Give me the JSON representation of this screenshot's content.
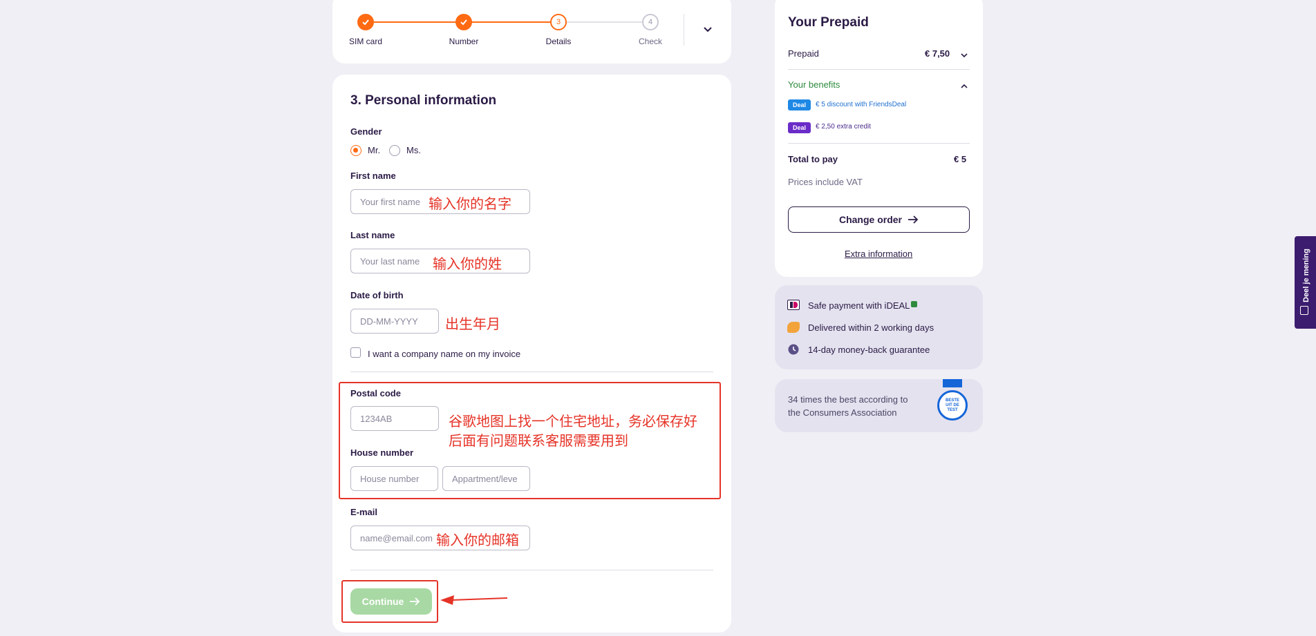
{
  "steps": [
    {
      "label": "SIM card",
      "status": "done",
      "number": ""
    },
    {
      "label": "Number",
      "status": "done",
      "number": ""
    },
    {
      "label": "Details",
      "status": "current",
      "number": "3"
    },
    {
      "label": "Check",
      "status": "todo",
      "number": "4"
    }
  ],
  "form": {
    "title": "3. Personal information",
    "gender_label": "Gender",
    "gender_options": [
      "Mr.",
      "Ms."
    ],
    "gender_selected": "Mr.",
    "first_name_label": "First name",
    "first_name_placeholder": "Your first name",
    "last_name_label": "Last name",
    "last_name_placeholder": "Your last name",
    "dob_label": "Date of birth",
    "dob_placeholder": "DD-MM-YYYY",
    "company_checkbox_label": "I want a company name on my invoice",
    "postal_label": "Postal code",
    "postal_placeholder": "1234AB",
    "house_label": "House number",
    "house_placeholder": "House number",
    "apartment_placeholder": "Appartment/leve",
    "email_label": "E-mail",
    "email_placeholder": "name@email.com",
    "continue_label": "Continue"
  },
  "annotations": {
    "first_name": "输入你的名字",
    "last_name": "输入你的姓",
    "dob": "出生年月",
    "address_line1": "谷歌地图上找一个住宅地址，务必保存好",
    "address_line2": "后面有问题联系客服需要用到",
    "email": "输入你的邮箱"
  },
  "summary": {
    "title": "Your Prepaid",
    "prepaid_label": "Prepaid",
    "prepaid_price": "€ 7,50",
    "benefits_label": "Your benefits",
    "deal_badge": "Deal",
    "benefit_1": "€ 5 discount with FriendsDeal",
    "benefit_2": "€ 2,50 extra credit",
    "total_label": "Total to pay",
    "total_value": "€ 5",
    "vat_note": "Prices include VAT",
    "change_order_label": "Change order",
    "extra_info_label": "Extra information"
  },
  "trust": {
    "item_1": "Safe payment with iDEAL",
    "item_2": "Delivered within 2 working days",
    "item_3": "14-day money-back guarantee"
  },
  "award": {
    "text_line1": "34 times the best according to",
    "text_line2": "the Consumers Association",
    "badge_text": "BESTE UIT DE TEST"
  },
  "feedback_tab": "Deel je mening",
  "colors": {
    "accent": "#ff6a13",
    "brand_dark": "#2a1a45",
    "annotation_red": "#e53327",
    "benefit_green": "#2e8b3d",
    "deal_blue": "#1e88e5",
    "deal_purple": "#6a2cc8",
    "continue_disabled": "#a8d9a4"
  }
}
